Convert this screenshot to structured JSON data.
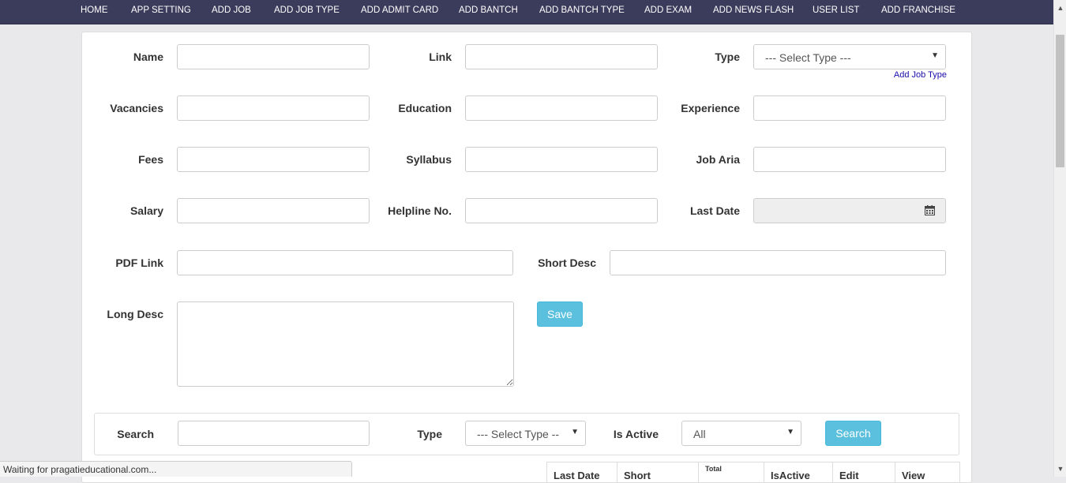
{
  "nav": {
    "items": [
      "HOME",
      "APP SETTING",
      "ADD JOB",
      "ADD JOB TYPE",
      "ADD ADMIT CARD",
      "ADD BANTCH",
      "ADD BANTCH TYPE",
      "ADD EXAM",
      "ADD NEWS FLASH",
      "USER LIST",
      "ADD FRANCHISE"
    ]
  },
  "form": {
    "name_label": "Name",
    "link_label": "Link",
    "type_label": "Type",
    "type_select": "--- Select Type ---",
    "add_job_type_link": "Add Job Type",
    "vacancies_label": "Vacancies",
    "education_label": "Education",
    "experience_label": "Experience",
    "fees_label": "Fees",
    "syllabus_label": "Syllabus",
    "job_aria_label": "Job Aria",
    "salary_label": "Salary",
    "helpline_label": "Helpline No.",
    "last_date_label": "Last Date",
    "pdf_link_label": "PDF Link",
    "short_desc_label": "Short Desc",
    "long_desc_label": "Long Desc",
    "save_button": "Save"
  },
  "search": {
    "search_label": "Search",
    "type_label": "Type",
    "type_select": "--- Select Type --",
    "is_active_label": "Is Active",
    "is_active_select": "All",
    "search_button": "Search"
  },
  "table": {
    "headers": [
      "Last Date",
      "Short",
      "Total",
      "IsActive",
      "Edit",
      "View"
    ]
  },
  "status_bar": "Waiting for pragatieducational.com...",
  "icons": {
    "calendar": "calendar-icon",
    "scroll_up": "chevron-up-icon",
    "scroll_down": "chevron-down-icon"
  }
}
